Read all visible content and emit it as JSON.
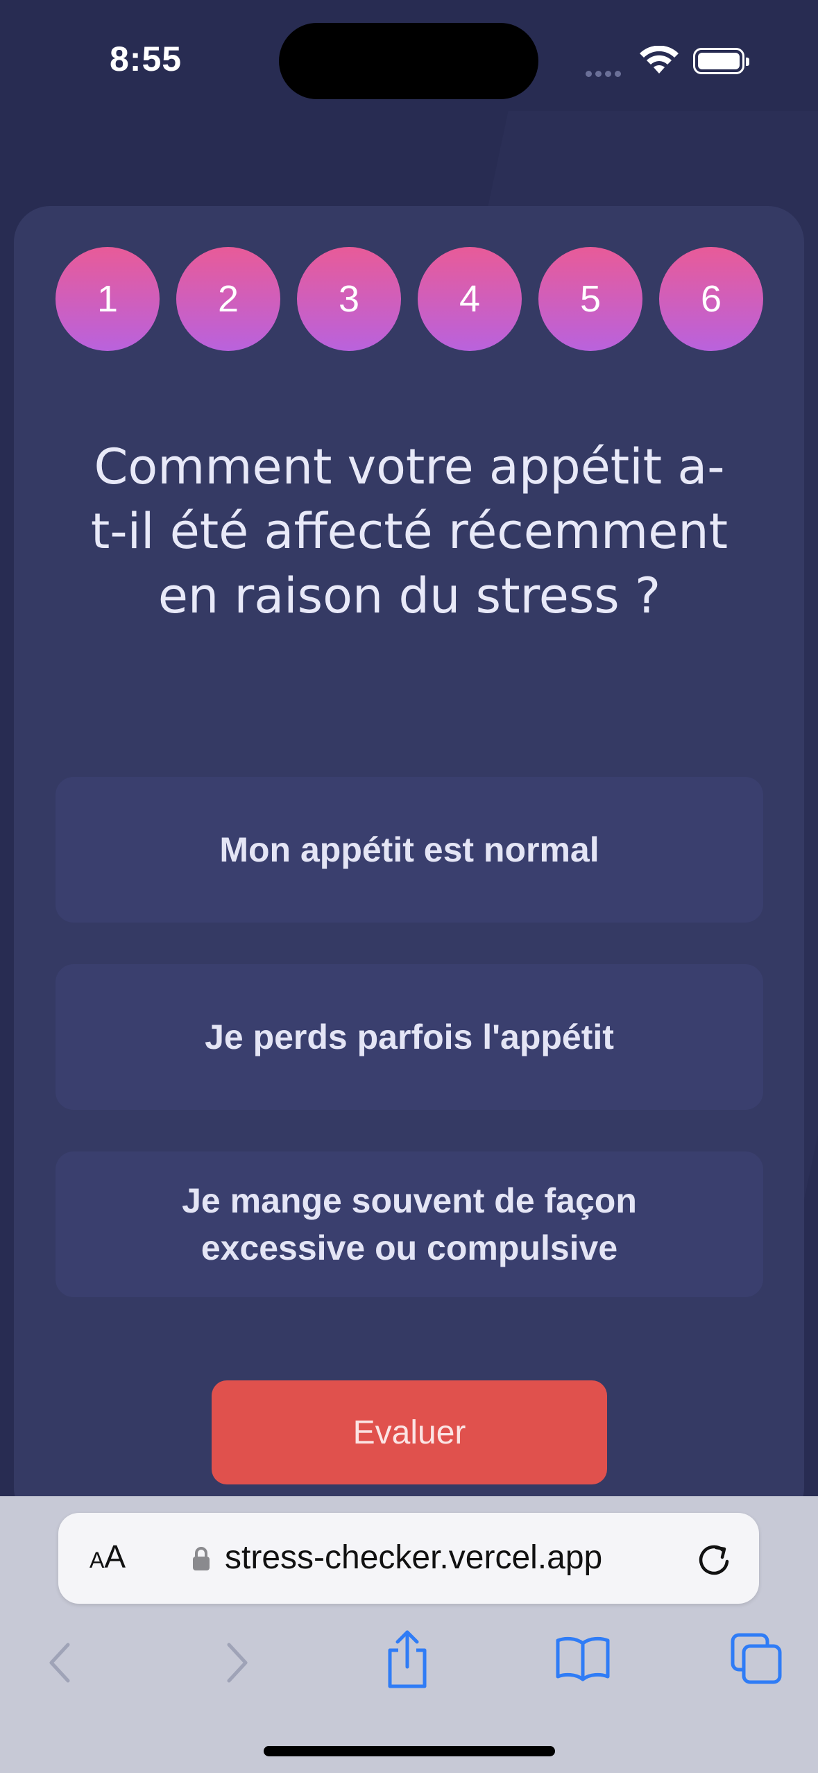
{
  "status_bar": {
    "time": "8:55"
  },
  "steps": [
    "1",
    "2",
    "3",
    "4",
    "5",
    "6"
  ],
  "question": "Comment votre appétit a-t-il été affecté récemment en raison du stress ?",
  "options": [
    "Mon appétit est normal",
    "Je perds parfois l'appétit",
    "Je mange souvent de façon excessive ou compulsive"
  ],
  "evaluate_label": "Evaluer",
  "browser": {
    "text_size_small": "A",
    "text_size_big": "A",
    "url": "stress-checker.vercel.app"
  },
  "colors": {
    "background": "#282c52",
    "card": "#353a64",
    "option": "#3a3f6e",
    "step_gradient_top": "#e85b98",
    "step_gradient_bottom": "#b962dd",
    "button": "#e0514d",
    "browser_accent": "#2f7cf6"
  },
  "icons": [
    "wifi-icon",
    "battery-icon",
    "lock-icon",
    "reload-icon",
    "back-icon",
    "forward-icon",
    "share-icon",
    "bookmarks-icon",
    "tabs-icon"
  ]
}
